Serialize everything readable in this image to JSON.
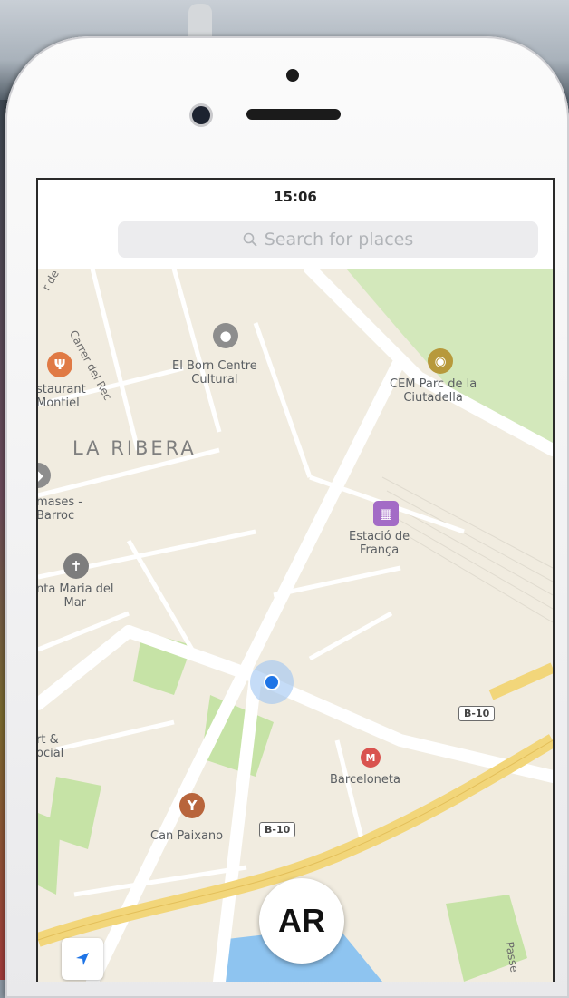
{
  "status_bar": {
    "time": "15:06"
  },
  "search": {
    "placeholder": "Search for places",
    "icon": "search-icon"
  },
  "map": {
    "district": "LA RIBERA",
    "streets": {
      "carrer_de": "r de",
      "carrer_del_rec": "Carrer del Rec",
      "passeig": "Passe"
    },
    "places": {
      "el_born": "El Born Centre\nCultural",
      "restaurant": "staurant\nMontiel",
      "cem_parc": "CEM Parc de la\nCiutadella",
      "damases": "mases -\nBarroc",
      "estacio": "Estació de\nFrança",
      "santa_maria": "nta Maria del\nMar",
      "art_social": "rt &\nocial",
      "barceloneta": "Barceloneta",
      "can_paixano": "Can Paixano"
    },
    "road_shields": [
      "B-10",
      "B-10"
    ],
    "colors": {
      "land": "#f1ece0",
      "park": "#cfe6b5",
      "highway": "#f2d67a",
      "water": "#8ec4f0",
      "user": "#1e74e6"
    }
  },
  "buttons": {
    "ar": "AR",
    "locate_icon": "location-arrow-icon"
  }
}
